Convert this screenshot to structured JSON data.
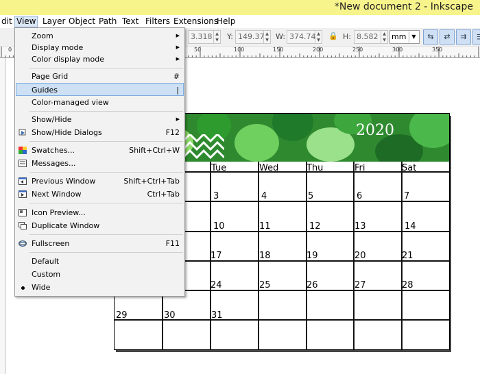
{
  "window": {
    "title": "*New document 2 - Inkscape"
  },
  "menubar": {
    "items": [
      "dit",
      "View",
      "Layer",
      "Object",
      "Path",
      "Text",
      "Filters",
      "Extensions",
      "Help"
    ]
  },
  "toolbar": {
    "x_value": "3.318",
    "y_label": "Y:",
    "y_value": "149.371",
    "w_label": "W:",
    "w_value": "374.744",
    "h_label": "H:",
    "h_value": "8.582",
    "unit": "mm"
  },
  "ruler": {
    "labels": [
      "0",
      "50",
      "100",
      "150",
      "200",
      "250",
      "300",
      "350"
    ]
  },
  "view_menu": {
    "items": [
      {
        "label": "Zoom",
        "shortcut": "",
        "submenu": true,
        "icon": ""
      },
      {
        "label": "Display mode",
        "shortcut": "",
        "submenu": true,
        "icon": ""
      },
      {
        "label": "Color display mode",
        "shortcut": "",
        "submenu": true,
        "icon": ""
      },
      {
        "label": "Page Grid",
        "shortcut": "#",
        "submenu": false,
        "icon": ""
      },
      {
        "label": "Guides",
        "shortcut": "|",
        "submenu": false,
        "icon": "",
        "highlighted": true
      },
      {
        "label": "Color-managed view",
        "shortcut": "",
        "submenu": false,
        "icon": ""
      },
      {
        "label": "Show/Hide",
        "shortcut": "",
        "submenu": true,
        "icon": ""
      },
      {
        "label": "Show/Hide Dialogs",
        "shortcut": "F12",
        "submenu": false,
        "icon": "dialogs-icon"
      },
      {
        "label": "Swatches...",
        "shortcut": "Shift+Ctrl+W",
        "submenu": false,
        "icon": "swatches-icon"
      },
      {
        "label": "Messages...",
        "shortcut": "",
        "submenu": false,
        "icon": "messages-icon"
      },
      {
        "label": "Previous Window",
        "shortcut": "Shift+Ctrl+Tab",
        "submenu": false,
        "icon": "previous-window-icon"
      },
      {
        "label": "Next Window",
        "shortcut": "Ctrl+Tab",
        "submenu": false,
        "icon": "next-window-icon"
      },
      {
        "label": "Icon Preview...",
        "shortcut": "",
        "submenu": false,
        "icon": "icon-preview-icon"
      },
      {
        "label": "Duplicate Window",
        "shortcut": "",
        "submenu": false,
        "icon": "duplicate-window-icon"
      },
      {
        "label": "Fullscreen",
        "shortcut": "F11",
        "submenu": false,
        "icon": "fullscreen-icon"
      },
      {
        "label": "Default",
        "shortcut": "",
        "submenu": false,
        "icon": ""
      },
      {
        "label": "Custom",
        "shortcut": "",
        "submenu": false,
        "icon": ""
      },
      {
        "label": "Wide",
        "shortcut": "",
        "submenu": false,
        "icon": "",
        "selected": true
      }
    ]
  },
  "calendar": {
    "year": "2020",
    "day_headers": [
      "Tue",
      "Wed",
      "Thu",
      "Fri",
      "Sat"
    ],
    "rows": [
      [
        "3",
        "4",
        "5",
        "6",
        "7"
      ],
      [
        "10",
        "11",
        "12",
        "13",
        "14"
      ],
      [
        "17",
        "18",
        "19",
        "20",
        "21"
      ],
      [
        "24",
        "25",
        "26",
        "27",
        "28"
      ]
    ],
    "last_row": [
      "29",
      "30",
      "31"
    ]
  },
  "colors": {
    "titlebar": "#f7f48c",
    "menu_highlight": "#cde0f4",
    "banner_green": "#2f8a2f"
  }
}
